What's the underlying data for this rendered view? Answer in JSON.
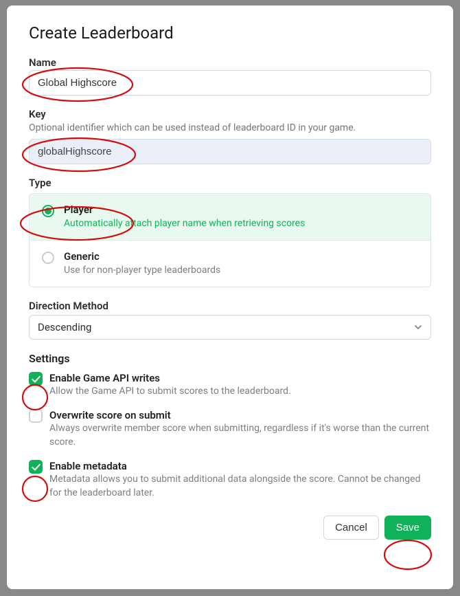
{
  "title": "Create Leaderboard",
  "name": {
    "label": "Name",
    "value": "Global Highscore"
  },
  "key": {
    "label": "Key",
    "hint": "Optional identifier which can be used instead of leaderboard ID in your game.",
    "value": "globalHighscore"
  },
  "type": {
    "label": "Type",
    "options": [
      {
        "title": "Player",
        "desc": "Automatically attach player name when retrieving scores",
        "selected": true
      },
      {
        "title": "Generic",
        "desc": "Use for non-player type leaderboards",
        "selected": false
      }
    ]
  },
  "direction": {
    "label": "Direction Method",
    "value": "Descending"
  },
  "settings": {
    "label": "Settings",
    "items": [
      {
        "title": "Enable Game API writes",
        "desc": "Allow the Game API to submit scores to the leaderboard.",
        "checked": true
      },
      {
        "title": "Overwrite score on submit",
        "desc": "Always overwrite member score when submitting, regardless if it's worse than the current score.",
        "checked": false
      },
      {
        "title": "Enable metadata",
        "desc": "Metadata allows you to submit additional data alongside the score. Cannot be changed for the leaderboard later.",
        "checked": true
      }
    ]
  },
  "footer": {
    "cancel": "Cancel",
    "save": "Save"
  },
  "annotation_color": "#d30d0d"
}
